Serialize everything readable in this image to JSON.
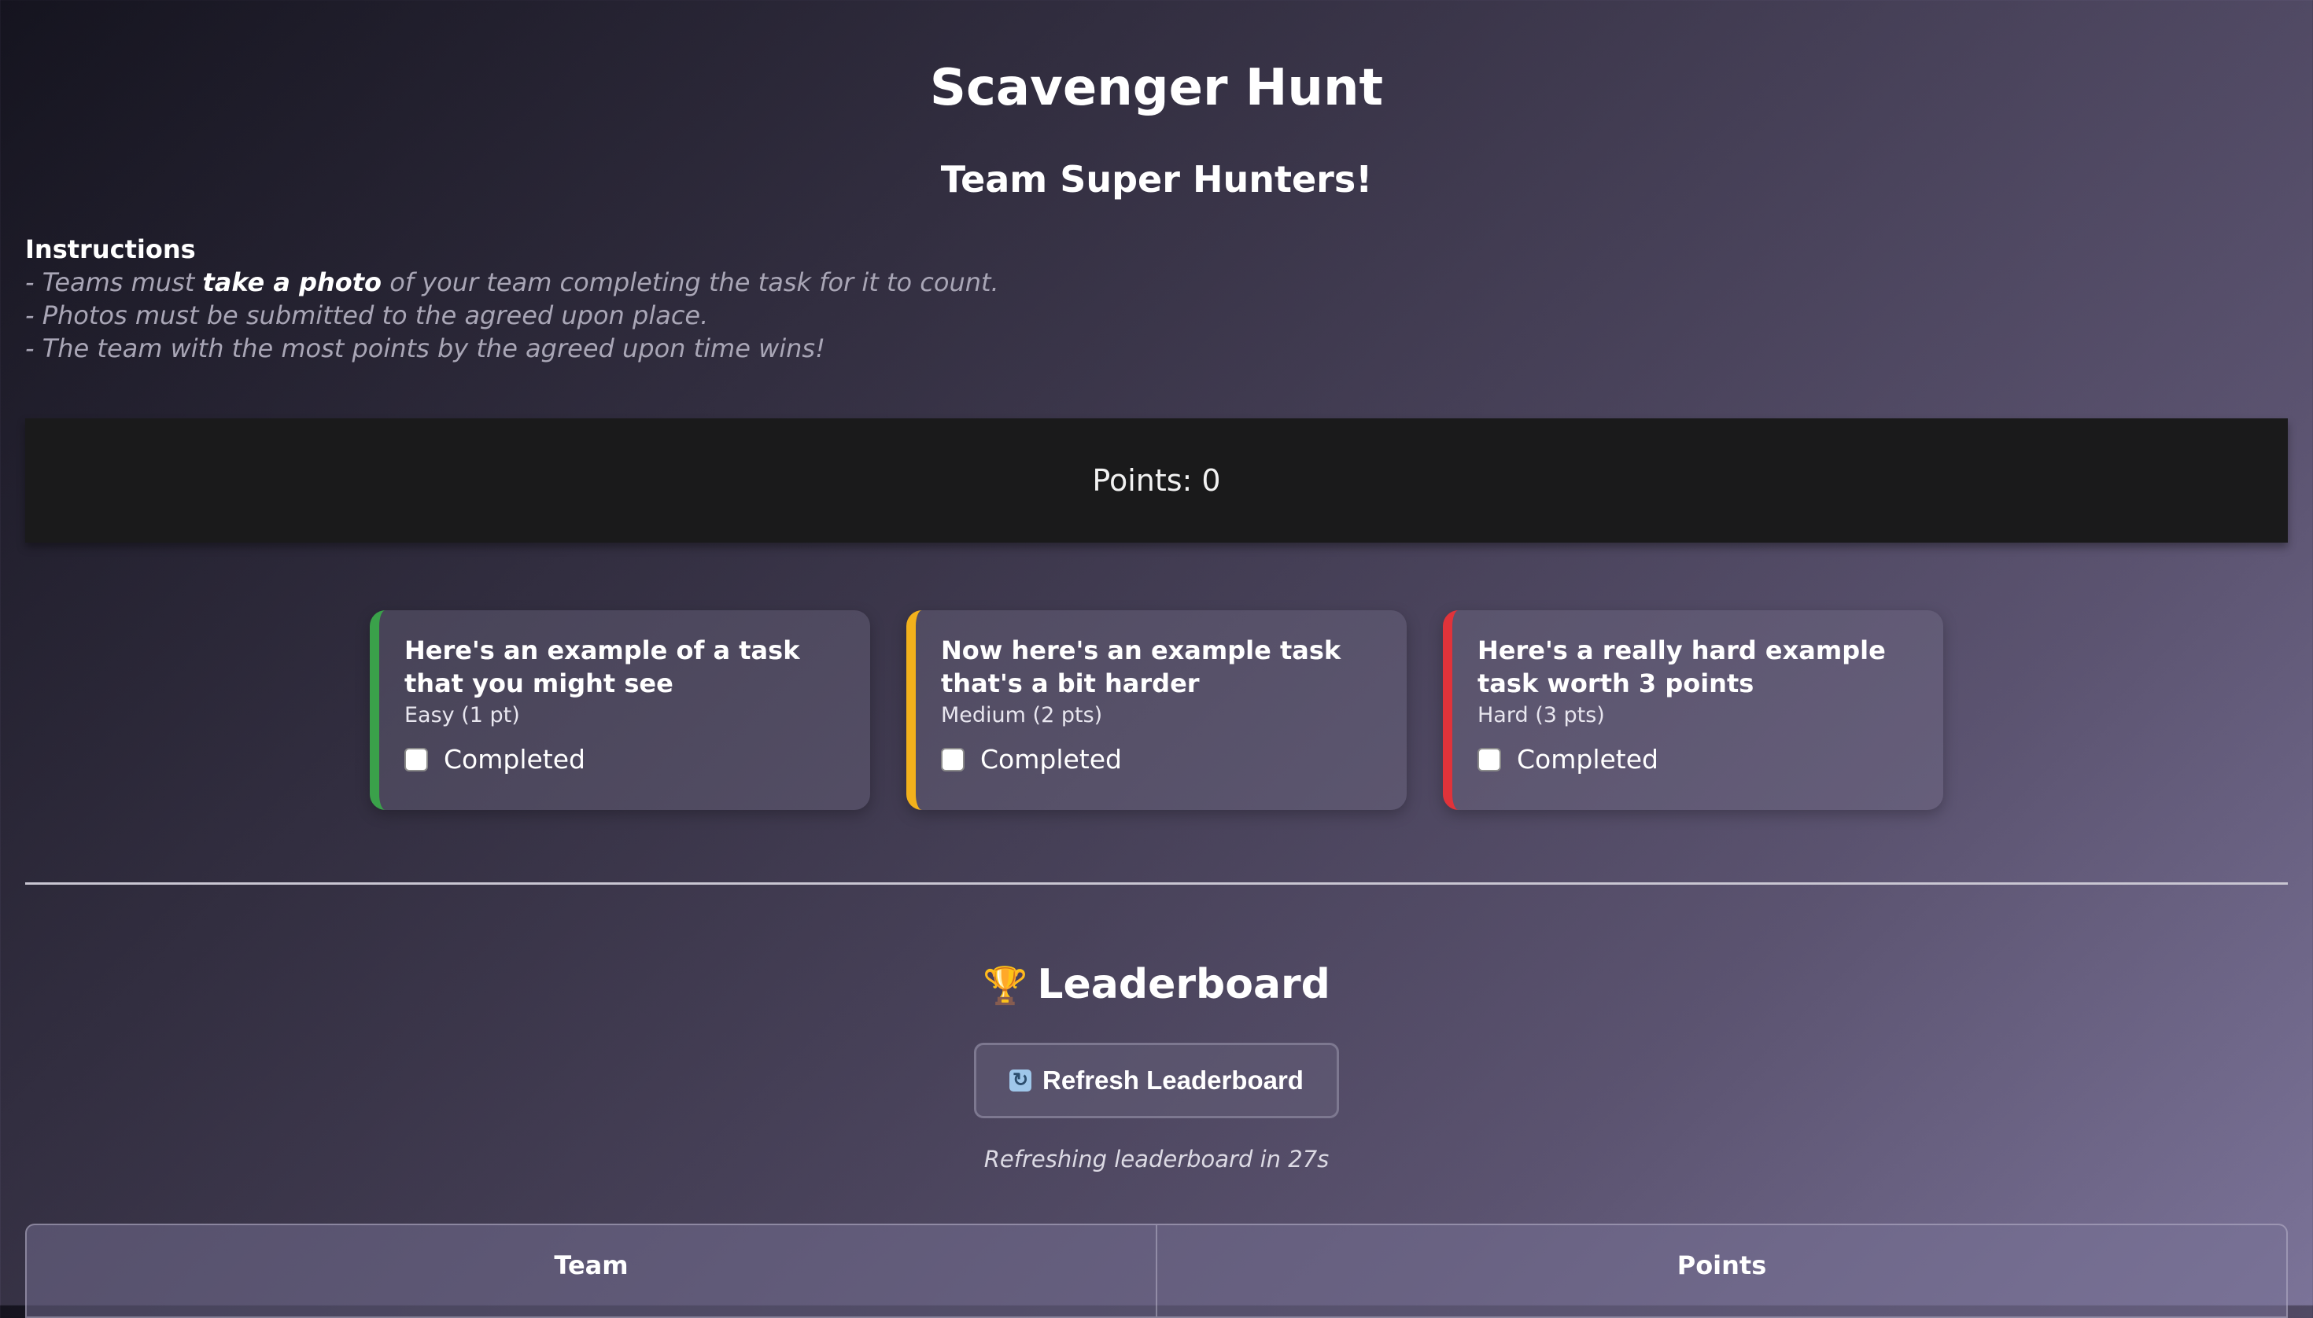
{
  "header": {
    "title": "Scavenger Hunt",
    "team_name": "Team Super Hunters!"
  },
  "instructions": {
    "title": "Instructions",
    "line1_pre": "- Teams must ",
    "line1_strong": "take a photo",
    "line1_post": " of your team completing the task for it to count.",
    "line2": "- Photos must be submitted to the agreed upon place.",
    "line3": "- The team with the most points by the agreed upon time wins!"
  },
  "points": {
    "label": "Points: 0"
  },
  "tasks": [
    {
      "title": "Here's an example of a task that you might see",
      "difficulty": "Easy (1 pt)",
      "completed_label": "Completed",
      "color": "#3aa14a"
    },
    {
      "title": "Now here's an example task that's a bit harder",
      "difficulty": "Medium (2 pts)",
      "completed_label": "Completed",
      "color": "#f2b11c"
    },
    {
      "title": "Here's a really hard example task worth 3 points",
      "difficulty": "Hard (3 pts)",
      "completed_label": "Completed",
      "color": "#e0333a"
    }
  ],
  "leaderboard": {
    "title": "Leaderboard",
    "refresh_label": "Refresh Leaderboard",
    "status": "Refreshing leaderboard in 27s",
    "columns": [
      "Team",
      "Points"
    ]
  },
  "icons": {
    "trophy": "trophy-icon",
    "refresh": "refresh-icon"
  }
}
